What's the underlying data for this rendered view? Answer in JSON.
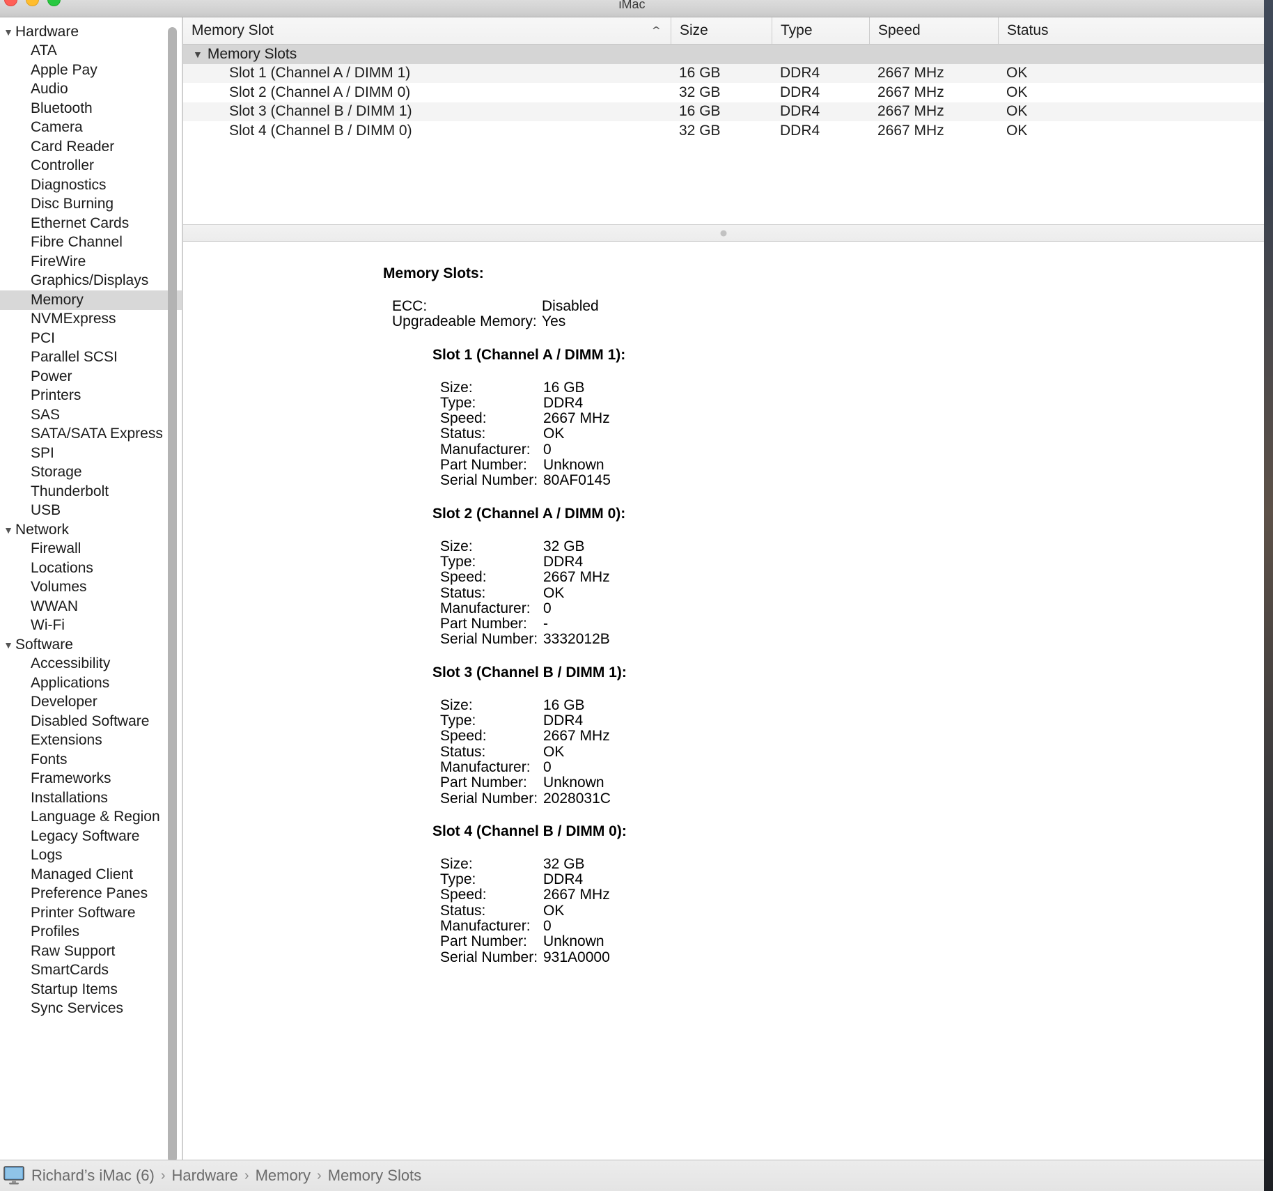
{
  "window": {
    "title": "iMac",
    "traffic_lights": [
      "close",
      "minimize",
      "maximize"
    ]
  },
  "sidebar": {
    "scrollbar": "vertical-scrollbar",
    "selected": "Memory",
    "entries": [
      {
        "type": "group",
        "label": "Hardware",
        "expanded": true
      },
      {
        "type": "item",
        "label": "ATA"
      },
      {
        "type": "item",
        "label": "Apple Pay"
      },
      {
        "type": "item",
        "label": "Audio"
      },
      {
        "type": "item",
        "label": "Bluetooth"
      },
      {
        "type": "item",
        "label": "Camera"
      },
      {
        "type": "item",
        "label": "Card Reader"
      },
      {
        "type": "item",
        "label": "Controller"
      },
      {
        "type": "item",
        "label": "Diagnostics"
      },
      {
        "type": "item",
        "label": "Disc Burning"
      },
      {
        "type": "item",
        "label": "Ethernet Cards"
      },
      {
        "type": "item",
        "label": "Fibre Channel"
      },
      {
        "type": "item",
        "label": "FireWire"
      },
      {
        "type": "item",
        "label": "Graphics/Displays"
      },
      {
        "type": "item",
        "label": "Memory",
        "selected": true
      },
      {
        "type": "item",
        "label": "NVMExpress"
      },
      {
        "type": "item",
        "label": "PCI"
      },
      {
        "type": "item",
        "label": "Parallel SCSI"
      },
      {
        "type": "item",
        "label": "Power"
      },
      {
        "type": "item",
        "label": "Printers"
      },
      {
        "type": "item",
        "label": "SAS"
      },
      {
        "type": "item",
        "label": "SATA/SATA Express"
      },
      {
        "type": "item",
        "label": "SPI"
      },
      {
        "type": "item",
        "label": "Storage"
      },
      {
        "type": "item",
        "label": "Thunderbolt"
      },
      {
        "type": "item",
        "label": "USB"
      },
      {
        "type": "group",
        "label": "Network",
        "expanded": true
      },
      {
        "type": "item",
        "label": "Firewall"
      },
      {
        "type": "item",
        "label": "Locations"
      },
      {
        "type": "item",
        "label": "Volumes"
      },
      {
        "type": "item",
        "label": "WWAN"
      },
      {
        "type": "item",
        "label": "Wi-Fi"
      },
      {
        "type": "group",
        "label": "Software",
        "expanded": true
      },
      {
        "type": "item",
        "label": "Accessibility"
      },
      {
        "type": "item",
        "label": "Applications"
      },
      {
        "type": "item",
        "label": "Developer"
      },
      {
        "type": "item",
        "label": "Disabled Software"
      },
      {
        "type": "item",
        "label": "Extensions"
      },
      {
        "type": "item",
        "label": "Fonts"
      },
      {
        "type": "item",
        "label": "Frameworks"
      },
      {
        "type": "item",
        "label": "Installations"
      },
      {
        "type": "item",
        "label": "Language & Region"
      },
      {
        "type": "item",
        "label": "Legacy Software"
      },
      {
        "type": "item",
        "label": "Logs"
      },
      {
        "type": "item",
        "label": "Managed Client"
      },
      {
        "type": "item",
        "label": "Preference Panes"
      },
      {
        "type": "item",
        "label": "Printer Software"
      },
      {
        "type": "item",
        "label": "Profiles"
      },
      {
        "type": "item",
        "label": "Raw Support"
      },
      {
        "type": "item",
        "label": "SmartCards"
      },
      {
        "type": "item",
        "label": "Startup Items"
      },
      {
        "type": "item",
        "label": "Sync Services"
      }
    ]
  },
  "table": {
    "columns": [
      {
        "key": "name",
        "label": "Memory Slot",
        "sorted": true,
        "sort_dir": "ascending",
        "sort_glyph": "⌃"
      },
      {
        "key": "size",
        "label": "Size"
      },
      {
        "key": "type",
        "label": "Type"
      },
      {
        "key": "speed",
        "label": "Speed"
      },
      {
        "key": "status",
        "label": "Status"
      }
    ],
    "group_row": {
      "label": "Memory Slots",
      "expanded": true,
      "disclosure_glyph": "▼"
    },
    "rows": [
      {
        "name": "Slot 1 (Channel A / DIMM 1)",
        "size": "16 GB",
        "type": "DDR4",
        "speed": "2667 MHz",
        "status": "OK"
      },
      {
        "name": "Slot 2 (Channel A / DIMM 0)",
        "size": "32 GB",
        "type": "DDR4",
        "speed": "2667 MHz",
        "status": "OK"
      },
      {
        "name": "Slot 3 (Channel B / DIMM 1)",
        "size": "16 GB",
        "type": "DDR4",
        "speed": "2667 MHz",
        "status": "OK"
      },
      {
        "name": "Slot 4 (Channel B / DIMM 0)",
        "size": "32 GB",
        "type": "DDR4",
        "speed": "2667 MHz",
        "status": "OK"
      }
    ]
  },
  "detail": {
    "title": "Memory Slots:",
    "summary": [
      {
        "key": "ECC:",
        "value": "Disabled"
      },
      {
        "key": "Upgradeable Memory:",
        "value": "Yes"
      }
    ],
    "slots": [
      {
        "heading": "Slot 1 (Channel A / DIMM 1):",
        "fields": [
          {
            "key": "Size:",
            "value": "16 GB"
          },
          {
            "key": "Type:",
            "value": "DDR4"
          },
          {
            "key": "Speed:",
            "value": "2667 MHz"
          },
          {
            "key": "Status:",
            "value": "OK"
          },
          {
            "key": "Manufacturer:",
            "value": "0"
          },
          {
            "key": "Part Number:",
            "value": "Unknown"
          },
          {
            "key": "Serial Number:",
            "value": "80AF0145"
          }
        ]
      },
      {
        "heading": "Slot 2 (Channel A / DIMM 0):",
        "fields": [
          {
            "key": "Size:",
            "value": "32 GB"
          },
          {
            "key": "Type:",
            "value": "DDR4"
          },
          {
            "key": "Speed:",
            "value": "2667 MHz"
          },
          {
            "key": "Status:",
            "value": "OK"
          },
          {
            "key": "Manufacturer:",
            "value": "0"
          },
          {
            "key": "Part Number:",
            "value": "-"
          },
          {
            "key": "Serial Number:",
            "value": "3332012B"
          }
        ]
      },
      {
        "heading": "Slot 3 (Channel B / DIMM 1):",
        "fields": [
          {
            "key": "Size:",
            "value": "16 GB"
          },
          {
            "key": "Type:",
            "value": "DDR4"
          },
          {
            "key": "Speed:",
            "value": "2667 MHz"
          },
          {
            "key": "Status:",
            "value": "OK"
          },
          {
            "key": "Manufacturer:",
            "value": "0"
          },
          {
            "key": "Part Number:",
            "value": "Unknown"
          },
          {
            "key": "Serial Number:",
            "value": "2028031C"
          }
        ]
      },
      {
        "heading": "Slot 4 (Channel B / DIMM 0):",
        "fields": [
          {
            "key": "Size:",
            "value": "32 GB"
          },
          {
            "key": "Type:",
            "value": "DDR4"
          },
          {
            "key": "Speed:",
            "value": "2667 MHz"
          },
          {
            "key": "Status:",
            "value": "OK"
          },
          {
            "key": "Manufacturer:",
            "value": "0"
          },
          {
            "key": "Part Number:",
            "value": "Unknown"
          },
          {
            "key": "Serial Number:",
            "value": "931A0000"
          }
        ]
      }
    ]
  },
  "statusbar": {
    "icon": "imac-icon",
    "separator": "›",
    "crumbs": [
      "Richard’s iMac (6)",
      "Hardware",
      "Memory",
      "Memory Slots"
    ]
  }
}
